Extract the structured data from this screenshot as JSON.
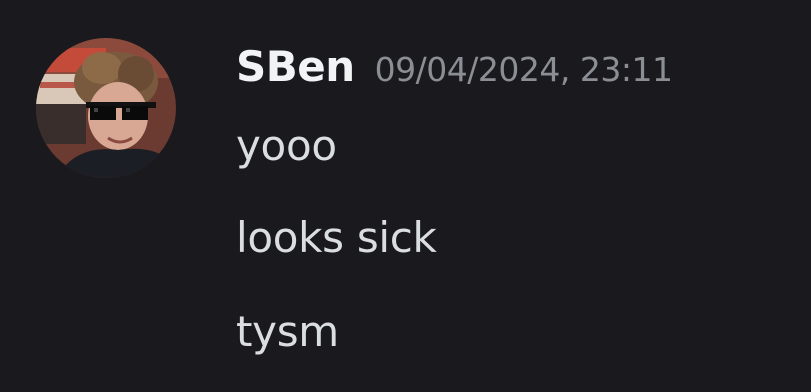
{
  "message_group": {
    "author": {
      "username": "SBen",
      "avatar_icon": "user-avatar-photo"
    },
    "timestamp": "09/04/2024, 23:11",
    "messages": [
      {
        "text": "yooo"
      },
      {
        "text": "looks sick"
      },
      {
        "text": "tysm"
      }
    ]
  },
  "colors": {
    "background": "#1a1a1e",
    "username": "#f2f3f5",
    "timestamp": "#8b8e95",
    "message_text": "#dbdee1"
  }
}
